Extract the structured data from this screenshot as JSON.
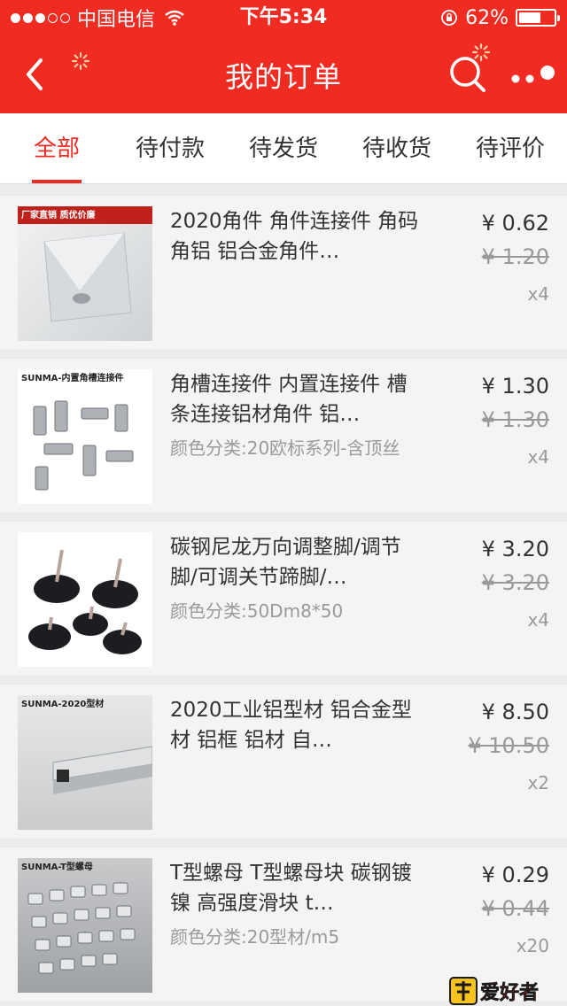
{
  "status_bar": {
    "carrier": "中国电信",
    "time": "下午5:34",
    "battery": "62%",
    "battery_level": 0.62
  },
  "nav": {
    "title": "我的订单",
    "back_icon": "back-chevron-icon",
    "search_icon": "search-icon",
    "more_icon": "more-dots-icon"
  },
  "tabs": [
    {
      "label": "全部",
      "active": true
    },
    {
      "label": "待付款",
      "active": false
    },
    {
      "label": "待发货",
      "active": false
    },
    {
      "label": "待收货",
      "active": false
    },
    {
      "label": "待评价",
      "active": false
    }
  ],
  "orders": [
    {
      "thumb_tag": "厂家直销 质优价廉",
      "title": "2020角件 角件连接件 角码 角铝 铝合金角件…",
      "spec": "",
      "price": "¥ 0.62",
      "old_price": "¥ 1.20",
      "qty": "x4"
    },
    {
      "thumb_tag": "SUNMA-内置角槽连接件",
      "title": "角槽连接件 内置连接件 槽条连接铝材角件 铝…",
      "spec": "颜色分类:20欧标系列-含顶丝",
      "price": "¥ 1.30",
      "old_price": "¥ 1.30",
      "qty": "x4"
    },
    {
      "thumb_tag": "",
      "title": "碳钢尼龙万向调整脚/调节脚/可调关节蹄脚/…",
      "spec": "颜色分类:50Dm8*50",
      "price": "¥ 3.20",
      "old_price": "¥ 3.20",
      "qty": "x4"
    },
    {
      "thumb_tag": "SUNMA-2020型材",
      "title": "2020工业铝型材 铝合金型材 铝框 铝材 自…",
      "spec": "",
      "price": "¥ 8.50",
      "old_price": "¥ 10.50",
      "qty": "x2"
    },
    {
      "thumb_tag": "SUNMA-T型螺母",
      "title": "T型螺母 T型螺母块 碳钢镀镍 高强度滑块 t…",
      "spec": "颜色分类:20型材/m5",
      "price": "¥ 0.29",
      "old_price": "¥ 0.44",
      "qty": "x20"
    }
  ],
  "watermark": "爱好者",
  "colors": {
    "brand": "#f02b22",
    "text": "#333333",
    "muted": "#999999"
  }
}
